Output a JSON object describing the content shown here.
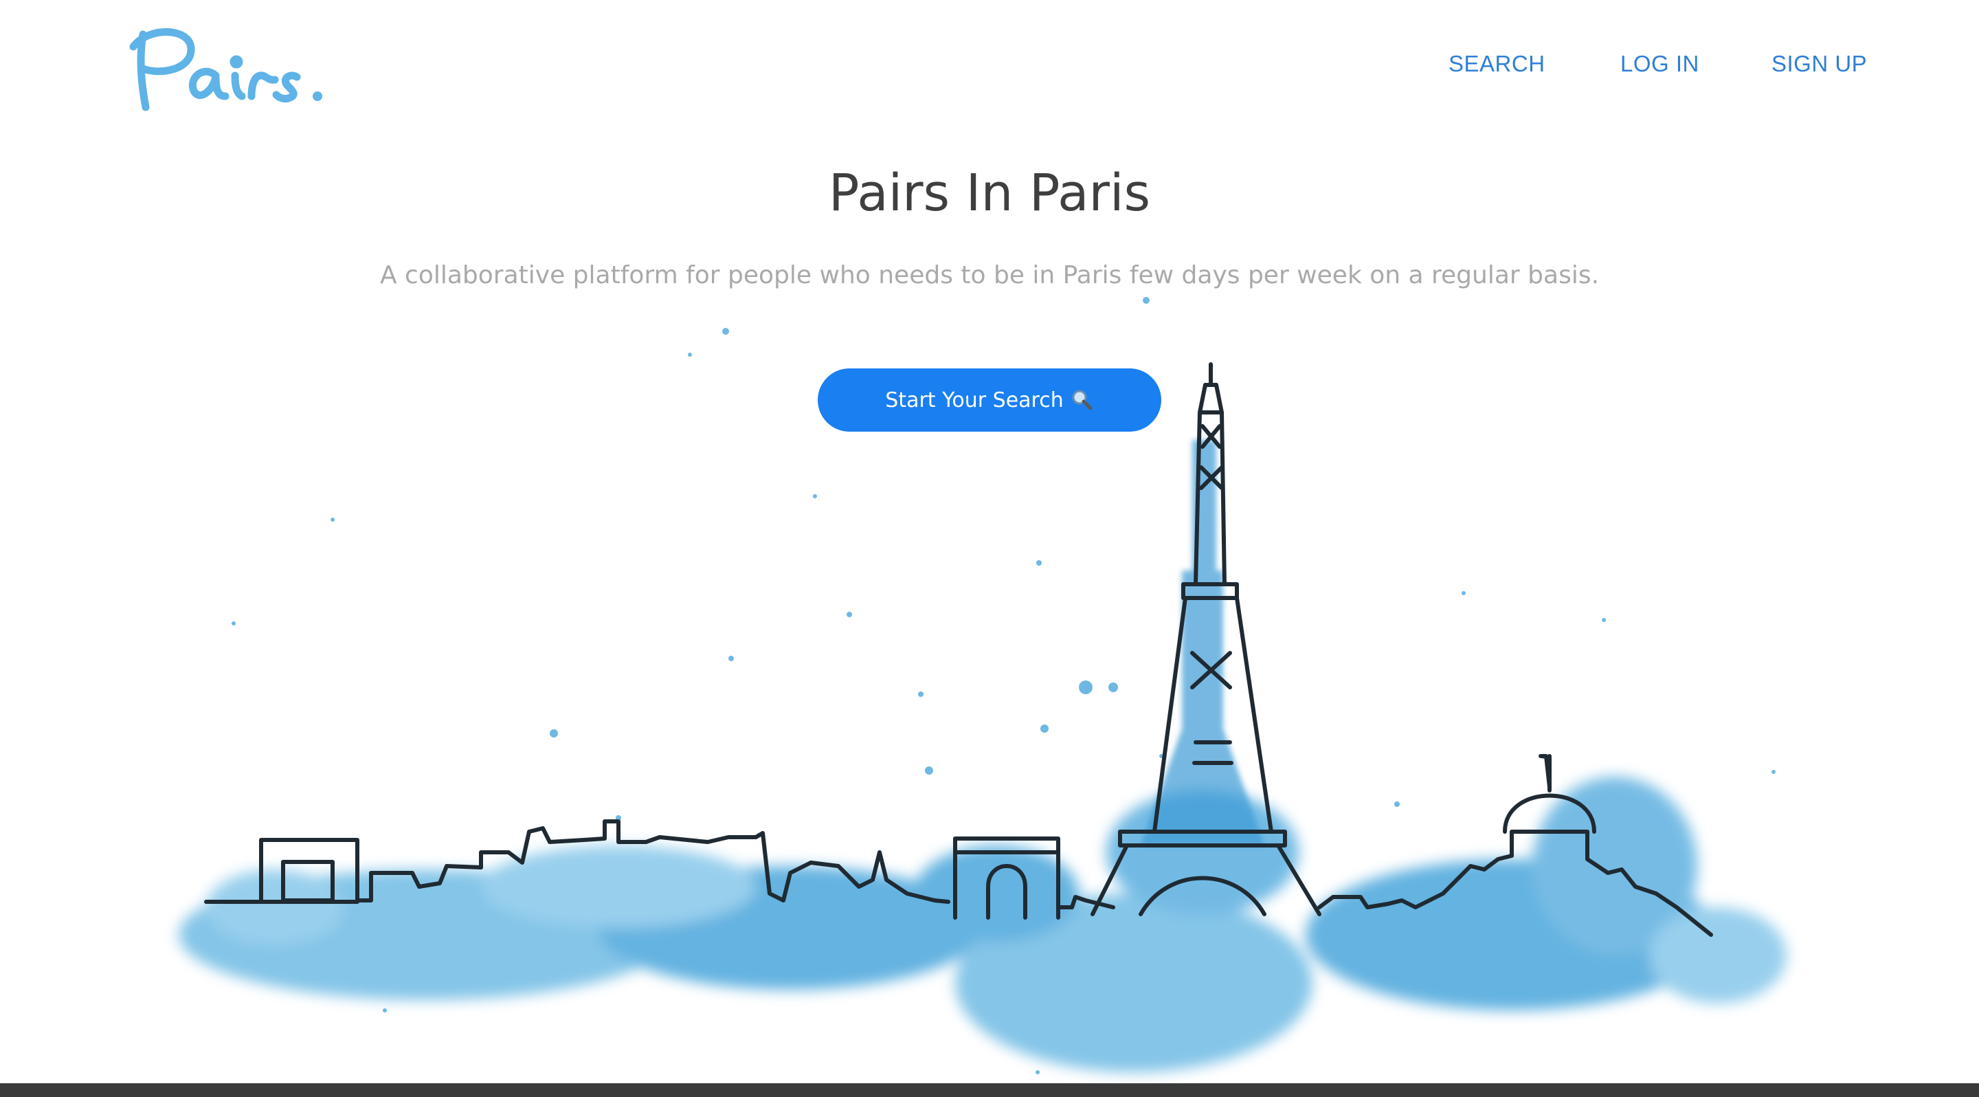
{
  "header": {
    "logo_text": "Pairs.",
    "nav": [
      {
        "label": "SEARCH"
      },
      {
        "label": "LOG IN"
      },
      {
        "label": "SIGN UP"
      }
    ]
  },
  "hero": {
    "title": "Pairs In Paris",
    "subtitle": "A collaborative platform for people who needs to be in Paris few days per week on a regular basis.",
    "cta_label": "Start Your Search",
    "cta_icon": "magnifier-icon"
  },
  "illustration": {
    "subject": "paris-skyline-watercolor",
    "colors": {
      "accent": "#1a7ff1",
      "ink": "#1f2a33",
      "wash": "#4aa6dc",
      "link": "#2f7fd6"
    }
  }
}
